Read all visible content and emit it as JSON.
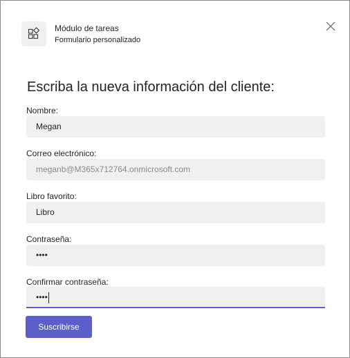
{
  "header": {
    "app_title": "Módulo de tareas",
    "app_subtitle": "Formulario personalizado",
    "app_icon": "apps-add-icon",
    "close_icon": "close-icon"
  },
  "form": {
    "heading": "Escriba la nueva información del cliente:",
    "fields": [
      {
        "label": "Nombre:",
        "value": "Megan"
      },
      {
        "label": "Correo electrónico:",
        "value": "meganb@M365x712764.onmicrosoft.com"
      },
      {
        "label": "Libro favorito:",
        "value": "Libro"
      },
      {
        "label": "Contraseña:",
        "value": "••••"
      },
      {
        "label": "Confirmar contraseña:",
        "value": "••••"
      }
    ],
    "submit_label": "Suscribirse"
  },
  "colors": {
    "accent": "#5b5fc7",
    "input_background": "#f0f0f0",
    "text": "#242424",
    "muted_text": "#8a8a8a"
  }
}
